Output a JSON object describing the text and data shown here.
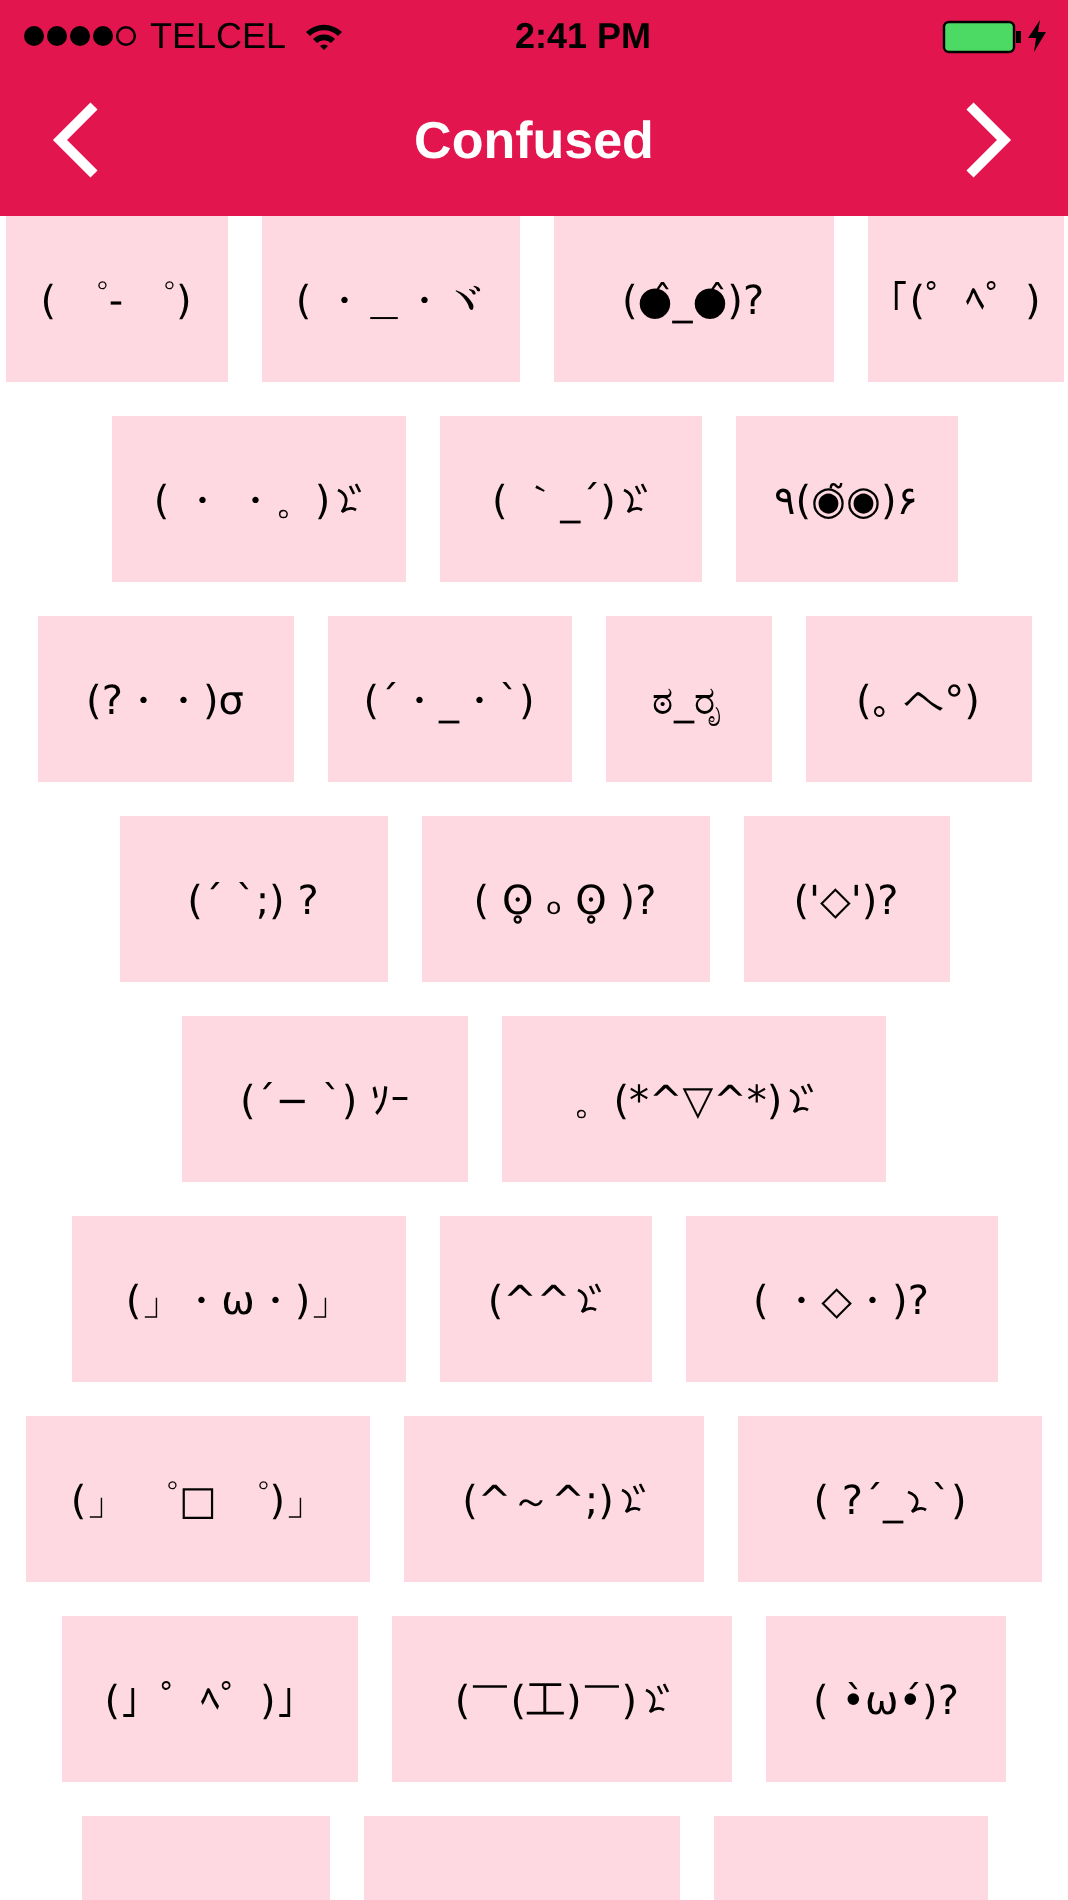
{
  "status_bar": {
    "carrier": "TELCEL",
    "time": "2:41 PM"
  },
  "nav": {
    "title": "Confused"
  },
  "rows": [
    {
      "tiles": [
        {
          "kind": "text",
          "parts": [
            {
              "kind": "text",
              "text": "( ゜- ゜)"
            }
          ]
        },
        {
          "kind": "text",
          "parts": [
            {
              "kind": "text",
              "text": "( ・＿・ヾ"
            }
          ]
        },
        {
          "kind": "text",
          "parts": [
            {
              "kind": "text",
              "text": "(●̂_●̂)?"
            }
          ]
        },
        {
          "kind": "text",
          "parts": [
            {
              "kind": "text",
              "text": "｢(゜ﾍ゜)"
            }
          ]
        }
      ]
    },
    {
      "tiles": [
        {
          "kind": "text",
          "parts": [
            {
              "kind": "text",
              "text": "( ・ ・。)"
            },
            {
              "kind": "voiced-swirl"
            }
          ]
        },
        {
          "kind": "text",
          "parts": [
            {
              "kind": "text",
              "text": "( ｀_´)"
            },
            {
              "kind": "voiced-swirl"
            }
          ]
        },
        {
          "kind": "text",
          "parts": [
            {
              "kind": "text",
              "text": "٩(◉̃◉)۶"
            }
          ]
        }
      ]
    },
    {
      "tiles": [
        {
          "kind": "text",
          "parts": [
            {
              "kind": "text",
              "text": "(?・・)σ"
            }
          ]
        },
        {
          "kind": "text",
          "parts": [
            {
              "kind": "text",
              "text": "(´・_・`)"
            }
          ]
        },
        {
          "kind": "text",
          "parts": [
            {
              "kind": "text",
              "text": "ಠ_ರೃ"
            }
          ]
        },
        {
          "kind": "text",
          "parts": [
            {
              "kind": "text",
              "text": "(｡ ヘ°)"
            }
          ]
        }
      ]
    },
    {
      "tiles": [
        {
          "kind": "text",
          "parts": [
            {
              "kind": "text",
              "text": "(´ `;) ?"
            }
          ]
        },
        {
          "kind": "text",
          "parts": [
            {
              "kind": "text",
              "text": "( ʘ̥ ₒ ʘ̥ )?"
            }
          ]
        },
        {
          "kind": "text",
          "parts": [
            {
              "kind": "text",
              "text": "('◇')?"
            }
          ]
        }
      ]
    },
    {
      "tiles": [
        {
          "kind": "text",
          "parts": [
            {
              "kind": "text",
              "text": "(´− `) ｿｰ"
            }
          ]
        },
        {
          "kind": "text",
          "parts": [
            {
              "kind": "text",
              "text": "。(*^▽^*)"
            },
            {
              "kind": "voiced-swirl"
            }
          ]
        }
      ]
    },
    {
      "tiles": [
        {
          "kind": "text",
          "parts": [
            {
              "kind": "text",
              "text": "(」・ω・)」"
            }
          ]
        },
        {
          "kind": "text",
          "parts": [
            {
              "kind": "text",
              "text": "(^^"
            },
            {
              "kind": "voiced-swirl"
            }
          ]
        },
        {
          "kind": "text",
          "parts": [
            {
              "kind": "text",
              "text": "( ・◇・)?"
            }
          ]
        }
      ]
    },
    {
      "tiles": [
        {
          "kind": "text",
          "parts": [
            {
              "kind": "text",
              "text": "(」 ゜□ ゜)」"
            }
          ]
        },
        {
          "kind": "text",
          "parts": [
            {
              "kind": "text",
              "text": "(^～^;)"
            },
            {
              "kind": "voiced-swirl"
            }
          ]
        },
        {
          "kind": "text",
          "parts": [
            {
              "kind": "text",
              "text": "( ?´_"
            },
            {
              "kind": "swirl"
            },
            {
              "kind": "text",
              "text": "`)"
            }
          ]
        }
      ]
    },
    {
      "tiles": [
        {
          "kind": "text",
          "parts": [
            {
              "kind": "text",
              "text": "(」゜ﾍ゜)」"
            }
          ]
        },
        {
          "kind": "text",
          "parts": [
            {
              "kind": "text",
              "text": "(￣(工)￣)"
            },
            {
              "kind": "voiced-swirl"
            }
          ]
        },
        {
          "kind": "text",
          "parts": [
            {
              "kind": "text",
              "text": "( •̀ω•́)?"
            }
          ]
        }
      ]
    },
    {
      "tiles": [
        {
          "kind": "partial"
        },
        {
          "kind": "partial"
        },
        {
          "kind": "partial"
        }
      ]
    }
  ]
}
